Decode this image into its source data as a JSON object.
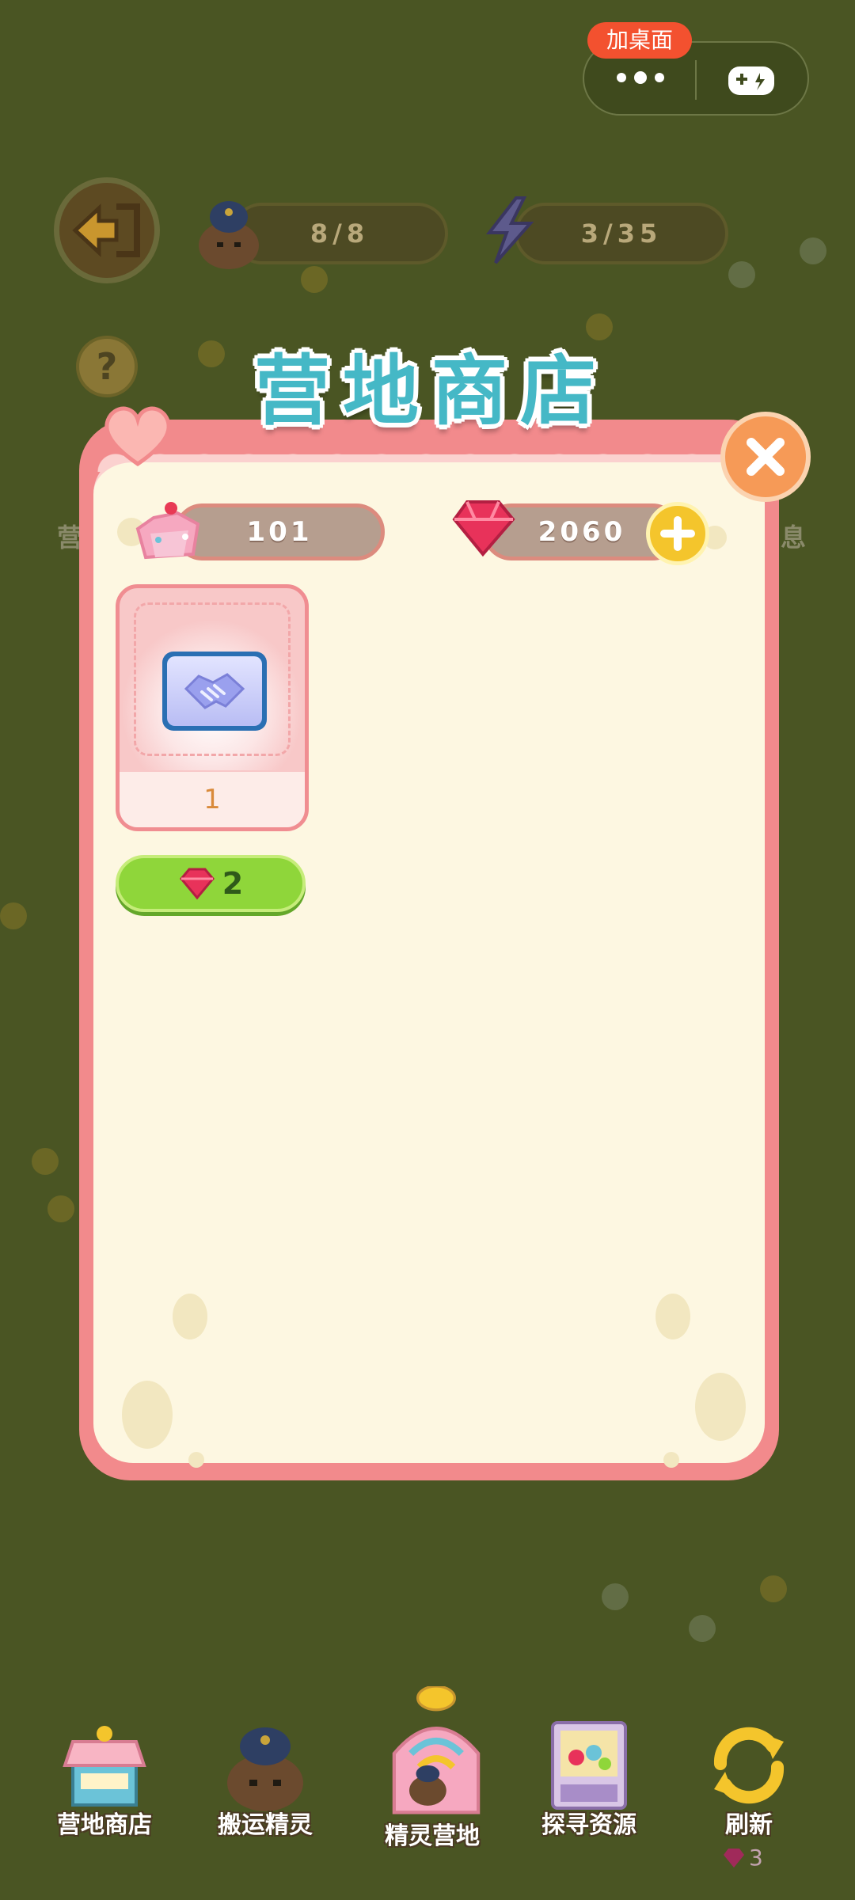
{
  "mini_program": {
    "add_desktop": "加桌面"
  },
  "hud": {
    "workers": "8/8",
    "energy": "3/35"
  },
  "panel": {
    "title": "营地商店",
    "dessert_count": "101",
    "gem_count": "2060",
    "items": [
      {
        "icon": "handshake-ticket-icon",
        "quantity": "1",
        "price": "2"
      }
    ]
  },
  "side_labels": {
    "left": "营",
    "right": "息"
  },
  "nav": {
    "items": [
      {
        "label": "营地商店",
        "icon": "shop-stall-icon"
      },
      {
        "label": "搬运精灵",
        "icon": "porter-sprite-icon"
      },
      {
        "label": "精灵营地",
        "icon": "sprite-camp-icon"
      },
      {
        "label": "探寻资源",
        "icon": "claw-machine-icon"
      },
      {
        "label": "刷新",
        "icon": "refresh-icon"
      }
    ],
    "refresh_cost": "3"
  },
  "colors": {
    "panel_pink": "#f28a8c",
    "panel_cream": "#fdf7e1",
    "title_teal": "#45b8c6",
    "buy_green": "#8fd63a",
    "gem_red": "#e8325a"
  }
}
